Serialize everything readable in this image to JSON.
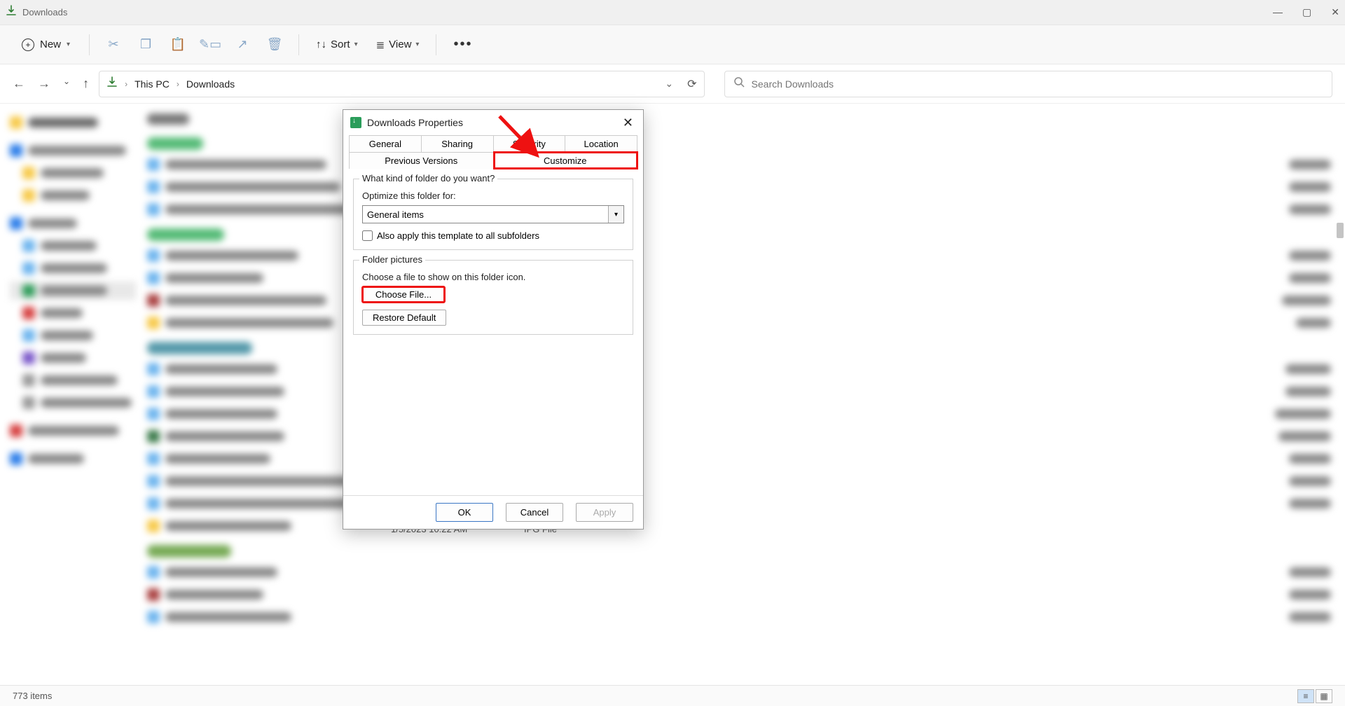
{
  "titlebar": {
    "title": "Downloads"
  },
  "toolbar": {
    "new_label": "New",
    "sort_label": "Sort",
    "view_label": "View"
  },
  "address": {
    "crumb1": "This PC",
    "crumb2": "Downloads"
  },
  "search": {
    "placeholder": "Search Downloads"
  },
  "statusbar": {
    "items": "773 items"
  },
  "visible_below": {
    "date": "1/5/2023 10:22 AM",
    "type": "IPG File"
  },
  "dialog": {
    "title": "Downloads Properties",
    "tabs": {
      "general": "General",
      "sharing": "Sharing",
      "security": "Security",
      "location": "Location",
      "previous": "Previous Versions",
      "customize": "Customize"
    },
    "folder_type": {
      "legend": "What kind of folder do you want?",
      "optimize_label": "Optimize this folder for:",
      "optimize_value": "General items",
      "apply_sub": "Also apply this template to all subfolders"
    },
    "folder_pictures": {
      "legend": "Folder pictures",
      "desc": "Choose a file to show on this folder icon.",
      "choose": "Choose File...",
      "restore": "Restore Default"
    },
    "buttons": {
      "ok": "OK",
      "cancel": "Cancel",
      "apply": "Apply"
    }
  }
}
